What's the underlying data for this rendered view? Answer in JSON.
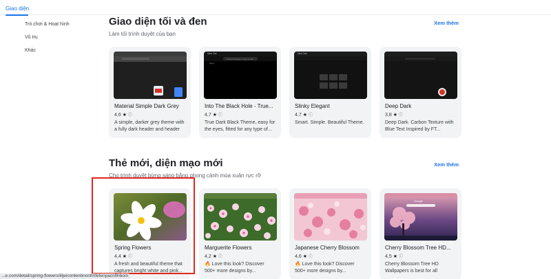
{
  "topnav": {
    "label": "Giao diện"
  },
  "sidebar": {
    "items": [
      {
        "label": "Trò chơi & Hoạt hình"
      },
      {
        "label": "Vũ trụ"
      },
      {
        "label": "Khác"
      }
    ]
  },
  "sections": [
    {
      "title": "Giao diện tối và đen",
      "subtitle": "Làm tối trình duyệt của bạn",
      "see_more": "Xem thêm",
      "cards": [
        {
          "name": "Material Simple Dark Grey",
          "rating": "4,6",
          "desc": "A simple, darker grey theme with a fully dark header and header bar."
        },
        {
          "name": "Into The Black Hole - True...",
          "rating": "4,7",
          "desc": "True Dark Black Theme, easy for the eyes, fitted for any type of...",
          "thumb_text_1": "New Tab",
          "thumb_text_2": "Search Google or type a URL",
          "thumb_text_3": "Apps"
        },
        {
          "name": "Slinky Elegant",
          "rating": "4,7",
          "desc": "Smart. Simple. Beautiful Theme.",
          "thumb_text_1": "New Tab"
        },
        {
          "name": "Deep Dark",
          "rating": "3,8",
          "desc": "Deep Dark. Carbon Texture with Blue Text Inspired by FT..."
        }
      ]
    },
    {
      "title": "Thẻ mới, diện mạo mới",
      "subtitle": "Cho trình duyệt bừng sáng bằng phong cảnh mùa xuân rực rỡ",
      "see_more": "Xem thêm",
      "cards": [
        {
          "name": "Spring Flowers",
          "rating": "4,4",
          "desc": "A fresh and beautiful theme that captures bright white and pink..."
        },
        {
          "name": "Marguerite Flowers",
          "rating": "4,2",
          "desc": "🔥 Love this look? Discover 500+ more designs by..."
        },
        {
          "name": "Japanese Cherry Blossom",
          "rating": "4,6",
          "desc": "🔥 Love this look? Discover 500+ more designs by..."
        },
        {
          "name": "Cherry Blossom Tree HD...",
          "rating": "4,5",
          "desc": "Cherry Blossom Tree HD Wallpapers is best for all chrome...",
          "thumb_text_1": "Google"
        }
      ]
    }
  ],
  "status_url": "...e.com/detail/spring-flowers/iiljeicnnlenbnonfmfefenpacnflhbom",
  "colors": {
    "accent": "#1a73e8",
    "highlight": "#e1261c",
    "card_bg": "#f1f3f4"
  }
}
